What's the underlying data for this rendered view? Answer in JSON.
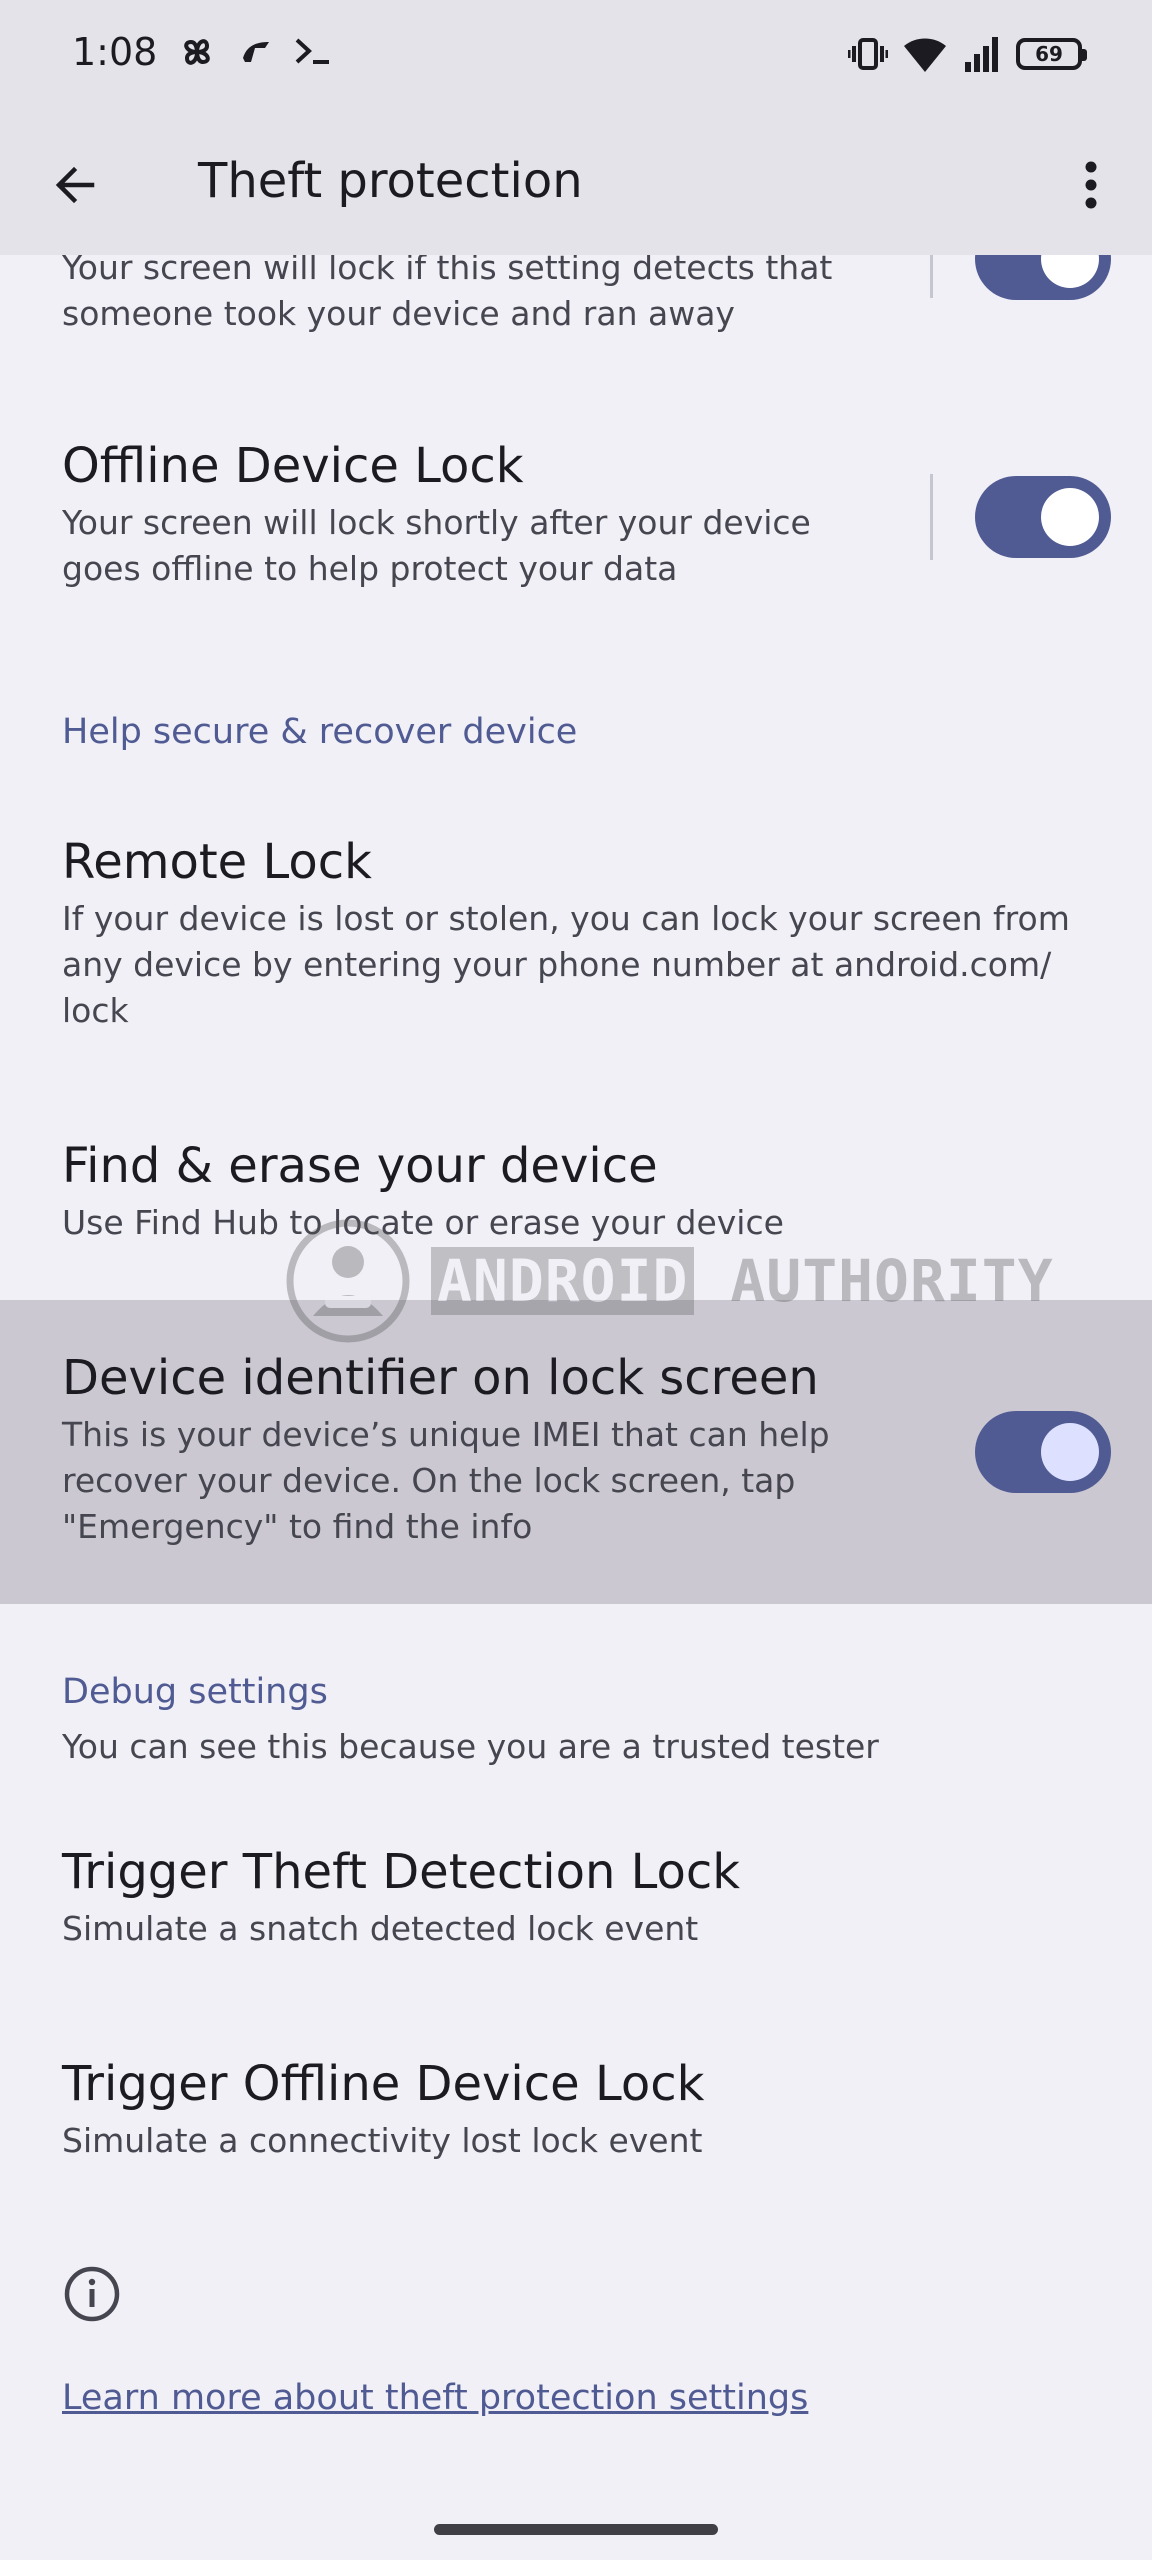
{
  "status_bar": {
    "time": "1:08",
    "battery_level": "69",
    "icons": [
      "pinwheel-icon",
      "speed-icon",
      "terminal-icon",
      "vibrate-icon",
      "wifi-icon",
      "signal-icon",
      "battery-icon"
    ]
  },
  "app_bar": {
    "title": "Theft protection",
    "back_icon": "arrow-back-icon",
    "more_icon": "more-vert-icon"
  },
  "items": {
    "theft_detection": {
      "subtitle_line1": "Your screen will lock if this setting detects that",
      "subtitle_line2": "someone took your device and ran away",
      "toggle_on": true
    },
    "offline_lock": {
      "title": "Offline Device Lock",
      "subtitle_line1": "Your screen will lock shortly after your device",
      "subtitle_line2": "goes offline to help protect your data",
      "toggle_on": true
    },
    "remote_lock": {
      "title": "Remote Lock",
      "subtitle_line1": "If your device is lost or stolen, you can lock your screen from",
      "subtitle_line2": "any device by entering your phone number at android.com/",
      "subtitle_line3": "lock"
    },
    "find_erase": {
      "title": "Find & erase your device",
      "subtitle": "Use Find Hub to locate or erase your device"
    },
    "device_identifier": {
      "title": "Device identifier on lock screen",
      "subtitle_line1": "This is your device’s unique IMEI that can help",
      "subtitle_line2": "recover your device. On the lock screen, tap",
      "subtitle_line3": "\"Emergency\" to find the info",
      "toggle_on": true
    },
    "trigger_theft": {
      "title": "Trigger Theft Detection Lock",
      "subtitle": "Simulate a snatch detected lock event"
    },
    "trigger_offline": {
      "title": "Trigger Offline Device Lock",
      "subtitle": "Simulate a connectivity lost lock event"
    }
  },
  "sections": {
    "help_secure": "Help secure & recover device",
    "debug": "Debug settings",
    "debug_note": "You can see this because you are a trusted tester"
  },
  "footer": {
    "info_icon": "info-icon",
    "learn_more": "Learn more about theft protection settings"
  },
  "watermark": {
    "word1": "ANDROID",
    "word2": "AUTHORITY"
  },
  "colors": {
    "accent": "#4f5b92",
    "background": "#f1f0f7",
    "app_bar": "#e4e3ea",
    "highlight": "#cbc8d2"
  }
}
